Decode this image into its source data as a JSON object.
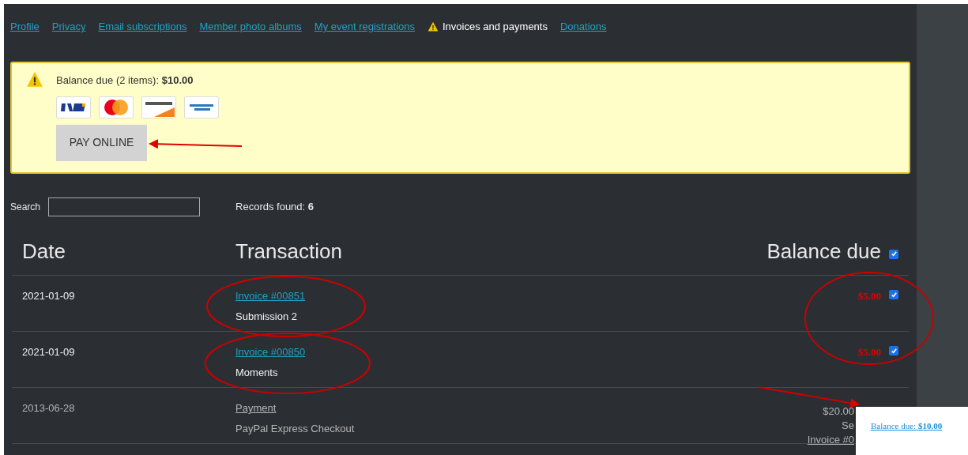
{
  "nav": [
    {
      "label": "Profile",
      "selected": false
    },
    {
      "label": "Privacy",
      "selected": false
    },
    {
      "label": "Email subscriptions",
      "selected": false
    },
    {
      "label": "Member photo albums",
      "selected": false
    },
    {
      "label": "My event registrations",
      "selected": false
    },
    {
      "label": "Invoices and payments",
      "selected": true
    },
    {
      "label": "Donations",
      "selected": false
    }
  ],
  "balance_notice": {
    "text": "Balance due (2 items): **$10.00**",
    "cards": [
      {
        "kind": "visa"
      },
      {
        "kind": "mastercard"
      },
      {
        "kind": "discover"
      },
      {
        "kind": "amex"
      }
    ],
    "button": "PAY ONLINE"
  },
  "search": {
    "label": "Search"
  },
  "records": "Records found: **6**",
  "table": {
    "columns": [
      "Date",
      "Transaction",
      "Balance due"
    ],
    "select_all_checked": true,
    "rows": [
      {
        "date": "2021-01-09",
        "link": "Invoice #00851",
        "detail": "Submission 2",
        "amount": [
          "$5.00"
        ],
        "due": true,
        "checked": true
      },
      {
        "date": "2021-01-09",
        "link": "Invoice #00850",
        "detail": "Moments",
        "amount": [
          "$5.00"
        ],
        "due": true,
        "checked": true
      },
      {
        "date": "2013-06-28",
        "link": "Payment",
        "detail": "PayPal Express Checkout",
        "amount": [
          "$20.00",
          "Se",
          "Invoice #0"
        ],
        "due": false
      }
    ]
  },
  "popup": {
    "text": "Balance due: **$10.00**"
  }
}
